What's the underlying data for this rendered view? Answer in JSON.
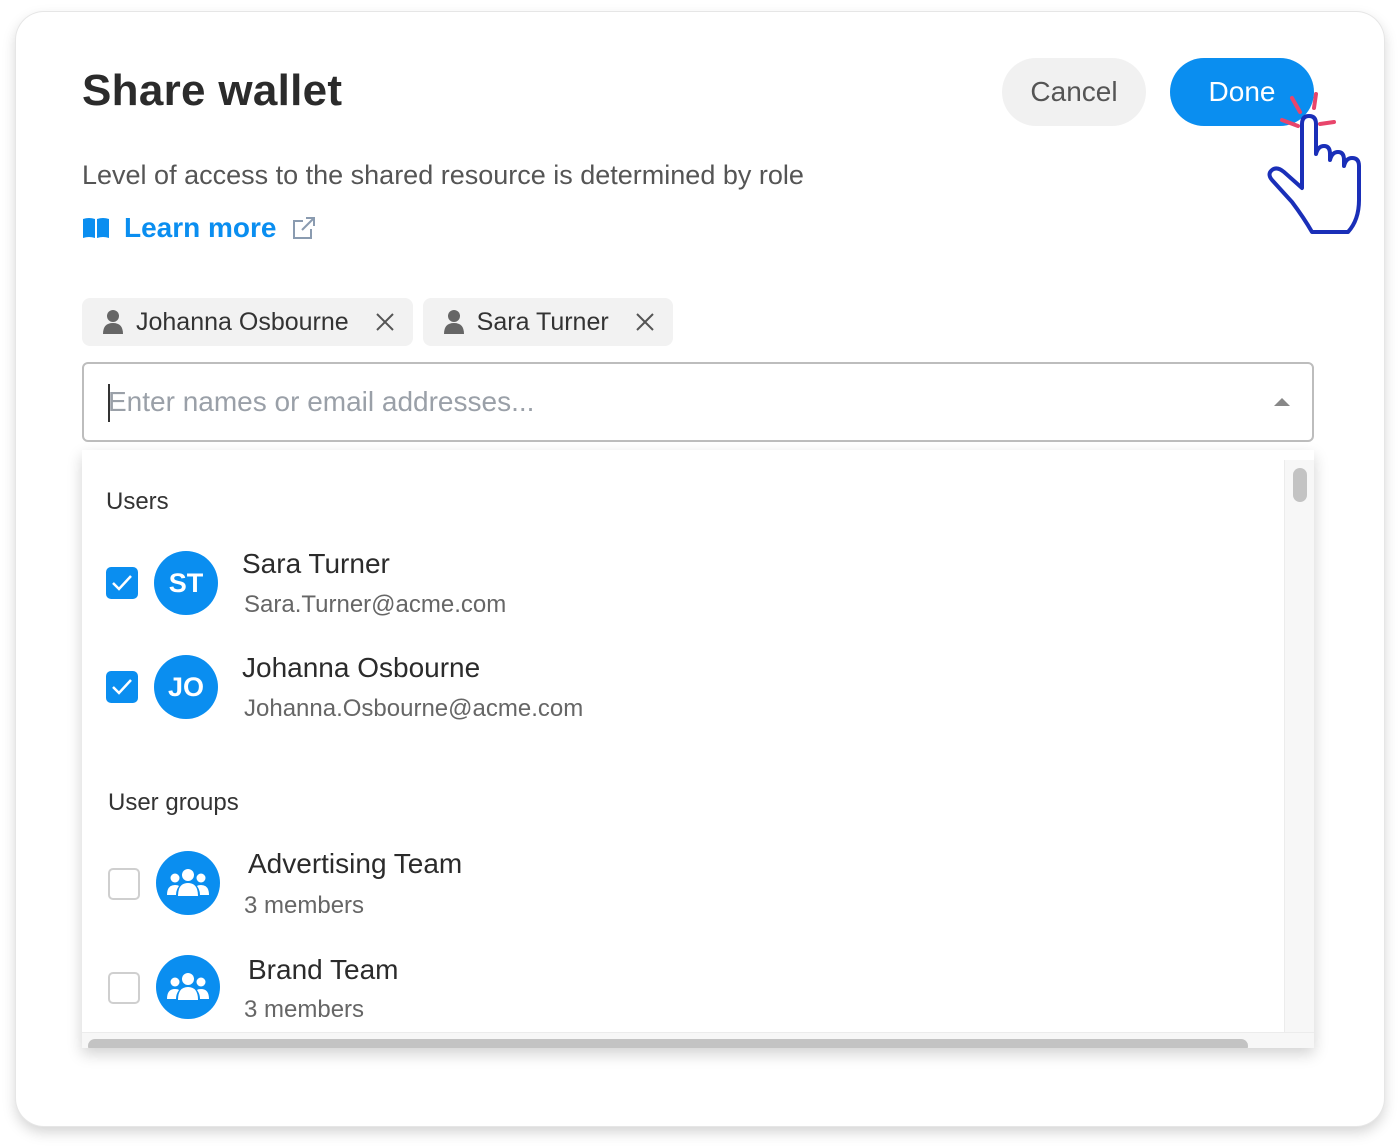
{
  "dialog": {
    "title": "Share wallet",
    "cancel_label": "Cancel",
    "done_label": "Done",
    "subtitle": "Level of access to the shared resource is determined by role",
    "learn_more": {
      "label": "Learn more",
      "icon": "book-icon",
      "trailing_icon": "external-link-icon"
    }
  },
  "selected_chips": [
    {
      "label": "Johanna Osbourne",
      "icon": "user-icon"
    },
    {
      "label": "Sara Turner",
      "icon": "user-icon"
    }
  ],
  "search": {
    "placeholder": "Enter names or email addresses...",
    "value": ""
  },
  "dropdown": {
    "users_label": "Users",
    "users": [
      {
        "initials": "ST",
        "name": "Sara Turner",
        "email": "Sara.Turner@acme.com",
        "checked": true
      },
      {
        "initials": "JO",
        "name": "Johanna Osbourne",
        "email": "Johanna.Osbourne@acme.com",
        "checked": true
      }
    ],
    "groups_label": "User groups",
    "groups": [
      {
        "name": "Advertising Team",
        "members": "3 members",
        "checked": false,
        "icon": "group-icon"
      },
      {
        "name": "Brand Team",
        "members": "3 members",
        "checked": false,
        "icon": "group-icon"
      }
    ]
  },
  "colors": {
    "accent": "#0a8ef0",
    "cursor_outline": "#1a2fb8",
    "click_burst": "#e8456b"
  }
}
